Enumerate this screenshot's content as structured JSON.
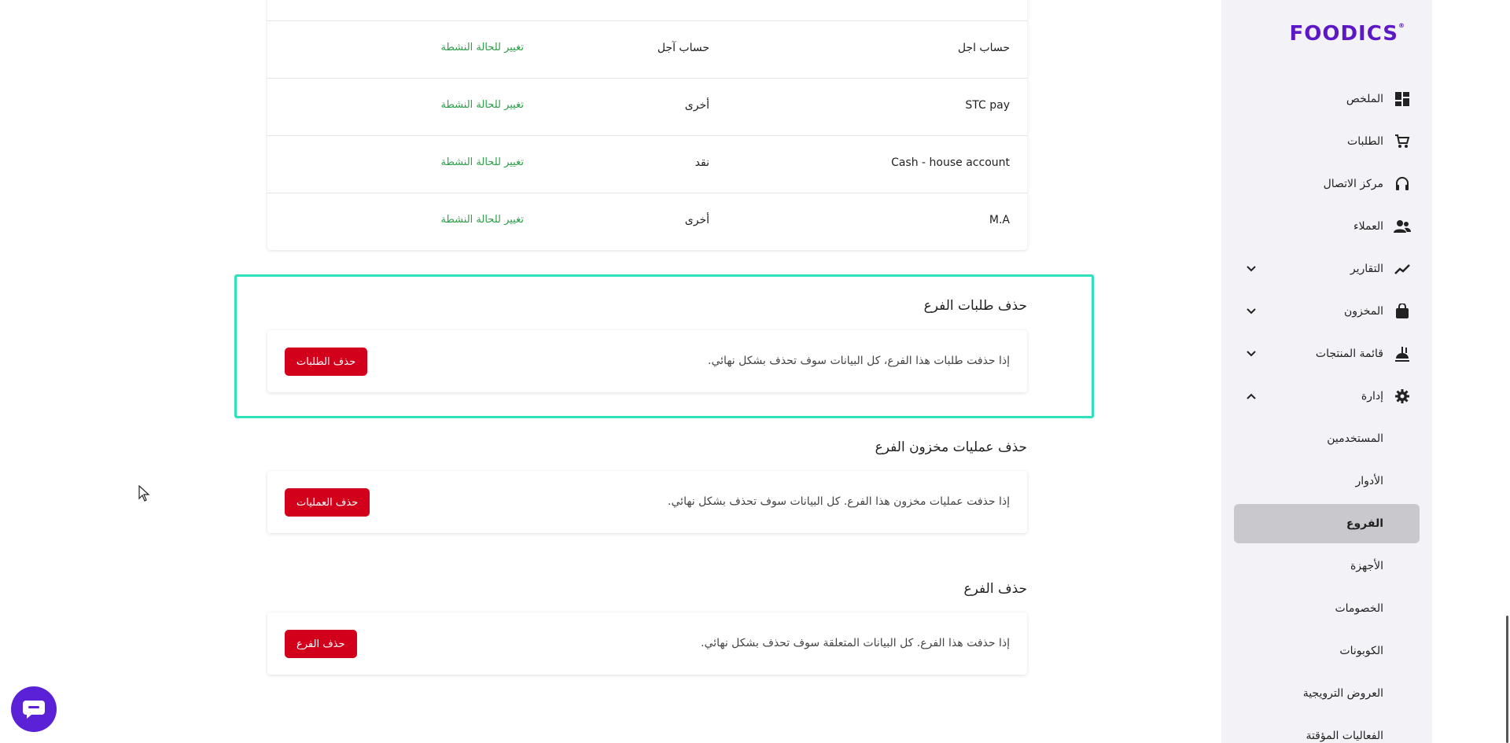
{
  "brand": {
    "logo_text": "FOODICS",
    "logo_mark": "®",
    "accent_color": "#5c17c7"
  },
  "sidebar": {
    "items": [
      {
        "label": "الملخص",
        "icon": "dashboard-icon"
      },
      {
        "label": "الطلبات",
        "icon": "cart-icon"
      },
      {
        "label": "مركز الاتصال",
        "icon": "headset-icon"
      },
      {
        "label": "العملاء",
        "icon": "people-icon"
      },
      {
        "label": "التقارير",
        "icon": "trending-icon",
        "expandable": true,
        "expanded": false
      },
      {
        "label": "المخزون",
        "icon": "bag-icon",
        "expandable": true,
        "expanded": false
      },
      {
        "label": "قائمة المنتجات",
        "icon": "food-icon",
        "expandable": true,
        "expanded": false
      },
      {
        "label": "إدارة",
        "icon": "gear-icon",
        "expandable": true,
        "expanded": true
      }
    ],
    "sub_items": [
      {
        "label": "المستخدمين"
      },
      {
        "label": "الأدوار"
      },
      {
        "label": "الفروع",
        "active": true
      },
      {
        "label": "الأجهزة"
      },
      {
        "label": "الخصومات"
      },
      {
        "label": "الكوبونات"
      },
      {
        "label": "العروض الترويجية"
      },
      {
        "label": "الفعاليات المؤقتة"
      }
    ]
  },
  "payment_methods": {
    "rows": [
      {
        "name": "حساب اجل",
        "type": "حساب آجل",
        "action": "تغيير للحالة النشطة"
      },
      {
        "name": "STC pay",
        "type": "أخرى",
        "action": "تغيير للحالة النشطة"
      },
      {
        "name": "Cash - house account",
        "type": "نقد",
        "action": "تغيير للحالة النشطة"
      },
      {
        "name": "M.A",
        "type": "أخرى",
        "action": "تغيير للحالة النشطة"
      }
    ]
  },
  "danger_zone": {
    "delete_orders": {
      "title": "حذف طلبات الفرع",
      "description": "إذا حذفت طلبات هذا الفرع، كل البيانات سوف تحذف بشكل نهائي.",
      "button": "حذف الطلبات"
    },
    "delete_inventory": {
      "title": "حذف عمليات مخزون الفرع",
      "description": "إذا حذفت عمليات مخزون هذا الفرع. كل البيانات سوف تحذف بشكل نهائي.",
      "button": "حذف العمليات"
    },
    "delete_branch": {
      "title": "حذف الفرع",
      "description": "إذا حذفت هذا الفرع. كل البيانات المتعلقة سوف تحذف بشكل نهائي.",
      "button": "حذف الفرع"
    }
  },
  "colors": {
    "danger": "#d3001c",
    "success_text": "#2e9d48",
    "highlight": "#2ee3bb",
    "chat": "#5b21d6"
  }
}
